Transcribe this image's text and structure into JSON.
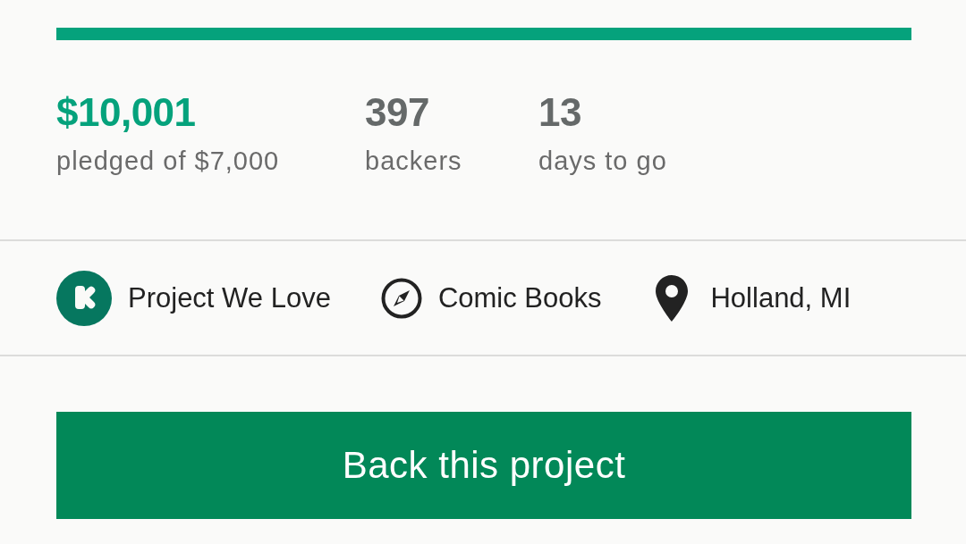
{
  "progress": {
    "level": 1
  },
  "stats": [
    {
      "value": "$10,001",
      "label": "pledged of $7,000",
      "color": "#05a27c"
    },
    {
      "value": "397",
      "label": "backers",
      "color": "#656969"
    },
    {
      "value": "13",
      "label": "days to go",
      "color": "#656969"
    }
  ],
  "tags": [
    {
      "kind": "badge",
      "label": "Project We Love"
    },
    {
      "kind": "category",
      "label": "Comic Books"
    },
    {
      "kind": "location",
      "label": "Holland, MI"
    }
  ],
  "button": {
    "label": "Back this project"
  }
}
